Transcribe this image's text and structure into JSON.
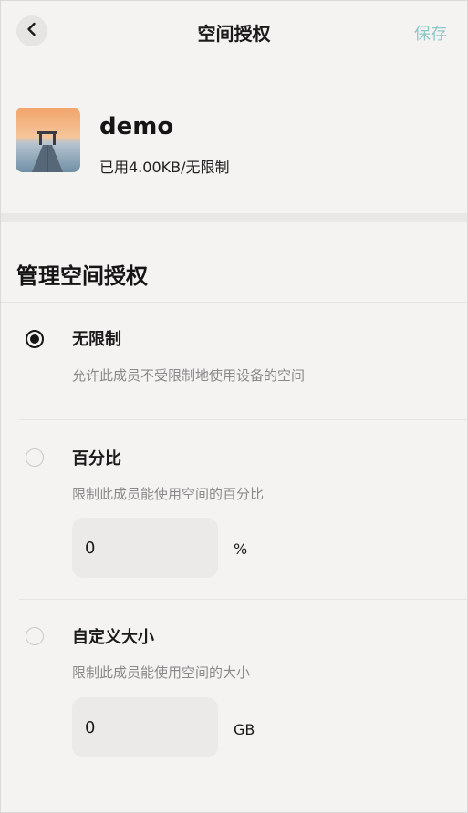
{
  "header": {
    "back_icon": "chevron-left-icon",
    "title": "空间授权",
    "save_label": "保存",
    "save_color": "#8fc7c8"
  },
  "profile": {
    "name": "demo",
    "usage": "已用4.00KB/无限制",
    "thumbnail": "pier-sunset-thumbnail"
  },
  "section": {
    "title": "管理空间授权"
  },
  "options": [
    {
      "label": "无限制",
      "description": "允许此成员不受限制地使用设备的空间",
      "selected": true
    },
    {
      "label": "百分比",
      "description": "限制此成员能使用空间的百分比",
      "selected": false,
      "input_value": "0",
      "unit": "%"
    },
    {
      "label": "自定义大小",
      "description": "限制此成员能使用空间的大小",
      "selected": false,
      "input_value": "0",
      "unit": "GB"
    }
  ]
}
